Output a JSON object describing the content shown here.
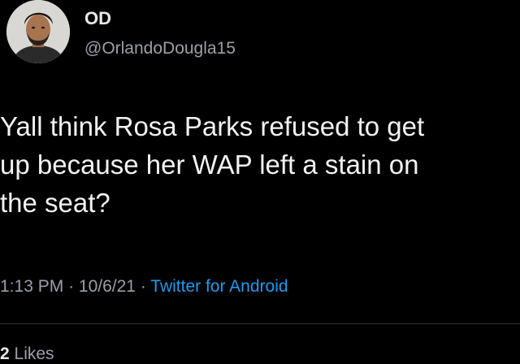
{
  "author": {
    "display_name": "OD",
    "handle": "@OrlandoDougla15",
    "avatar_icon": "profile-photo"
  },
  "tweet": {
    "text": "Yall think Rosa Parks refused to get\nup because her WAP left a stain on\nthe seat?"
  },
  "meta": {
    "time": "1:13 PM",
    "separator": "·",
    "date": "10/6/21",
    "source": "Twitter for Android"
  },
  "engagement": {
    "likes_count": "2",
    "likes_label": "Likes"
  },
  "colors": {
    "background": "#000000",
    "text": "#e7e9ea",
    "secondary": "#9aa0a6",
    "accent": "#1d9bf0"
  }
}
